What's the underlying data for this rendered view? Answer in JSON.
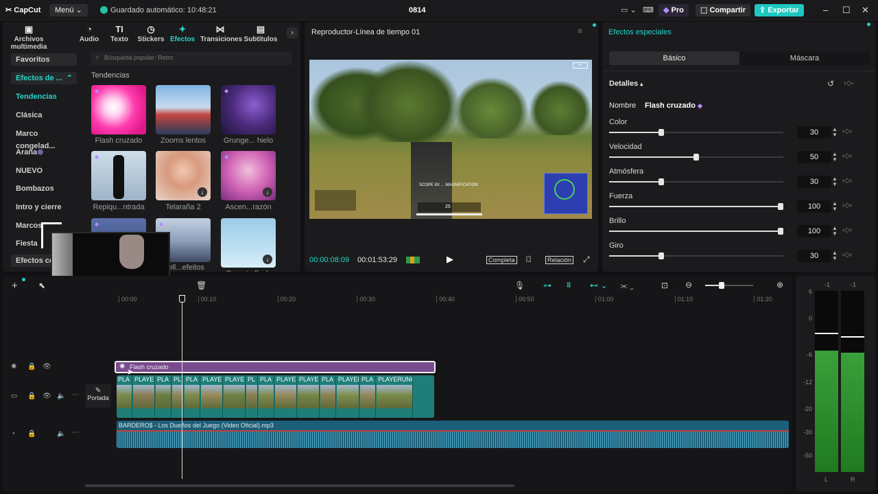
{
  "app": {
    "logo": "CapCut",
    "menu": "Menú",
    "autosave": "Guardado automático: 10:48:21",
    "project": "0814",
    "pro": "Pro",
    "share": "Compartir",
    "export": "Exportar"
  },
  "tools": [
    {
      "label": "Archivos multimedia",
      "icon": "media-icon"
    },
    {
      "label": "Audio",
      "icon": "audio-icon"
    },
    {
      "label": "Texto",
      "icon": "text-icon"
    },
    {
      "label": "Stickers",
      "icon": "sticker-icon"
    },
    {
      "label": "Efectos",
      "icon": "effects-icon"
    },
    {
      "label": "Transiciones",
      "icon": "transitions-icon"
    },
    {
      "label": "Subtítulos",
      "icon": "subtitles-icon"
    }
  ],
  "search": {
    "placeholder": "Búsqueda popular: Retro"
  },
  "categories": [
    "Favoritos",
    "Efectos de ...",
    "Tendencias",
    "Clásica",
    "Marco congelad...",
    "Araña",
    "NUEVO",
    "Bombazos",
    "Intro y cierre",
    "Marcos",
    "Fiesta",
    "Efectos co"
  ],
  "section_title": "Tendencias",
  "effects": [
    {
      "name": "Flash cruzado"
    },
    {
      "name": "Zooms lentos"
    },
    {
      "name": "Grunge... hielo"
    },
    {
      "name": "Repiqu...ntrada"
    },
    {
      "name": "Telaraña 2"
    },
    {
      "name": "Ascen...razón"
    },
    {
      "name": ""
    },
    {
      "name": "...ell...efeitos"
    },
    {
      "name": "Recort...flash"
    }
  ],
  "player": {
    "title": "Reproductor-Línea de tiempo 01",
    "current": "00:00:08:09",
    "total": "00:01:53:29",
    "full": "Completa",
    "ratio": "Relación",
    "hud_text": "SCOPE 8X ... MAGNIFICATION",
    "hud_ammo": "25"
  },
  "props": {
    "title": "Efectos especiales",
    "tab_basic": "Básico",
    "tab_mask": "Máscara",
    "details": "Detalles",
    "name_label": "Nombre",
    "name_value": "Flash cruzado",
    "params": [
      {
        "label": "Color",
        "value": "30",
        "level": 0.3
      },
      {
        "label": "Velocidad",
        "value": "50",
        "level": 0.5
      },
      {
        "label": "Atmósfera",
        "value": "30",
        "level": 0.3
      },
      {
        "label": "Fuerza",
        "value": "100",
        "level": 1
      },
      {
        "label": "Brillo",
        "value": "100",
        "level": 1
      },
      {
        "label": "Giro",
        "value": "30",
        "level": 0.3
      }
    ]
  },
  "timeline": {
    "ticks": [
      "00:00",
      "00:10",
      "00:20",
      "00:30",
      "00:40",
      "00:50",
      "01:00",
      "01:10",
      "01:20"
    ],
    "effect_clip": "Flash cruzado",
    "cover": "Portada",
    "audio_clip": "BARDERO$ - Los Dueños del Juego (Video Oficial).mp3",
    "video_labels": [
      "PLA",
      "PLAYE",
      "PLA",
      "PL",
      "PLA",
      "PLAYE",
      "PLAYE",
      "PL",
      "PLA",
      "PLAYE",
      "PLAYE",
      "PLA",
      "PLAYER",
      "PLA",
      "PLAYERUNK"
    ]
  },
  "meter": {
    "top": [
      "-1",
      "-1"
    ],
    "scale": [
      "6",
      "0",
      "-6",
      "-12",
      "-20",
      "-30",
      "-50"
    ],
    "ch": [
      "L",
      "R"
    ],
    "levels": [
      0.67,
      0.66
    ]
  },
  "colors": {
    "accent": "#26d5c8",
    "effect_clip": "#7a4a8e",
    "video_clip": "#1f7e78",
    "audio_clip": "#1b5f78"
  }
}
